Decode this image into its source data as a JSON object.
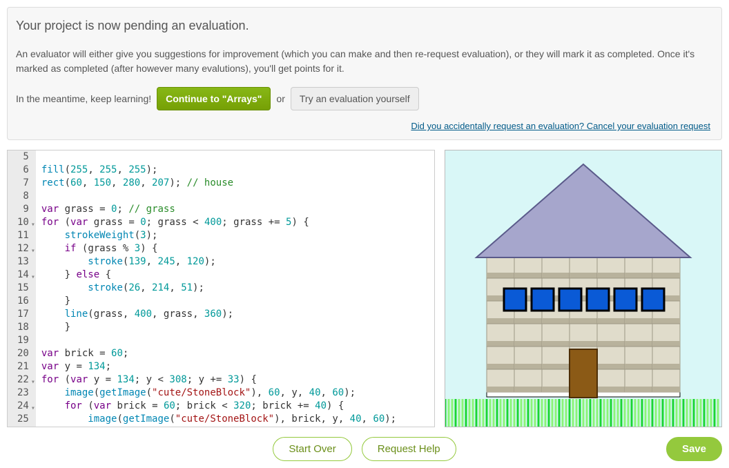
{
  "banner": {
    "title": "Your project is now pending an evaluation.",
    "text": "An evaluator will either give you suggestions for improvement (which you can make and then re-request evaluation), or they will mark it as completed. Once it's marked as completed (after however many evalutions), you'll get points for it.",
    "meantime": "In the meantime, keep learning!",
    "continue_btn": "Continue to \"Arrays\"",
    "or": "or",
    "try_btn": "Try an evaluation yourself",
    "cancel_link": "Did you accidentally request an evaluation? Cancel your evaluation request"
  },
  "gutter": [
    {
      "n": "5",
      "fold": false
    },
    {
      "n": "6",
      "fold": false
    },
    {
      "n": "7",
      "fold": false
    },
    {
      "n": "8",
      "fold": false
    },
    {
      "n": "9",
      "fold": false
    },
    {
      "n": "10",
      "fold": true
    },
    {
      "n": "11",
      "fold": false
    },
    {
      "n": "12",
      "fold": true
    },
    {
      "n": "13",
      "fold": false
    },
    {
      "n": "14",
      "fold": true
    },
    {
      "n": "15",
      "fold": false
    },
    {
      "n": "16",
      "fold": false
    },
    {
      "n": "17",
      "fold": false
    },
    {
      "n": "18",
      "fold": false
    },
    {
      "n": "19",
      "fold": false
    },
    {
      "n": "20",
      "fold": false
    },
    {
      "n": "21",
      "fold": false
    },
    {
      "n": "22",
      "fold": true
    },
    {
      "n": "23",
      "fold": false
    },
    {
      "n": "24",
      "fold": true
    },
    {
      "n": "25",
      "fold": false
    }
  ],
  "code_lines": [
    "",
    "<span class='typ'>fill</span><span class='pun'>(</span><span class='num'>255</span><span class='pun'>, </span><span class='num'>255</span><span class='pun'>, </span><span class='num'>255</span><span class='pun'>);</span>",
    "<span class='typ'>rect</span><span class='pun'>(</span><span class='num'>60</span><span class='pun'>, </span><span class='num'>150</span><span class='pun'>, </span><span class='num'>280</span><span class='pun'>, </span><span class='num'>207</span><span class='pun'>);</span> <span class='com'>// house</span>",
    "",
    "<span class='kw'>var</span> grass <span class='pun'>=</span> <span class='num'>0</span><span class='pun'>;</span> <span class='com'>// grass</span>",
    "<span class='kw'>for</span> <span class='pun'>(</span><span class='kw'>var</span> grass <span class='pun'>=</span> <span class='num'>0</span><span class='pun'>;</span> grass <span class='pun'>&lt;</span> <span class='num'>400</span><span class='pun'>;</span> grass <span class='pun'>+=</span> <span class='num'>5</span><span class='pun'>) {</span>",
    "    <span class='typ'>strokeWeight</span><span class='pun'>(</span><span class='num'>3</span><span class='pun'>);</span>",
    "    <span class='kw'>if</span> <span class='pun'>(</span>grass <span class='pun'>%</span> <span class='num'>3</span><span class='pun'>) {</span>",
    "        <span class='typ'>stroke</span><span class='pun'>(</span><span class='num'>139</span><span class='pun'>, </span><span class='num'>245</span><span class='pun'>, </span><span class='num'>120</span><span class='pun'>);</span>",
    "    <span class='pun'>}</span> <span class='kw'>else</span> <span class='pun'>{</span>",
    "        <span class='typ'>stroke</span><span class='pun'>(</span><span class='num'>26</span><span class='pun'>, </span><span class='num'>214</span><span class='pun'>, </span><span class='num'>51</span><span class='pun'>);</span>",
    "    <span class='pun'>}</span>",
    "    <span class='typ'>line</span><span class='pun'>(</span>grass<span class='pun'>, </span><span class='num'>400</span><span class='pun'>, </span>grass<span class='pun'>, </span><span class='num'>360</span><span class='pun'>);</span>",
    "    <span class='pun'>}</span>",
    "",
    "<span class='kw'>var</span> brick <span class='pun'>=</span> <span class='num'>60</span><span class='pun'>;</span>",
    "<span class='kw'>var</span> y <span class='pun'>=</span> <span class='num'>134</span><span class='pun'>;</span>",
    "<span class='kw'>for</span> <span class='pun'>(</span><span class='kw'>var</span> y <span class='pun'>=</span> <span class='num'>134</span><span class='pun'>;</span> y <span class='pun'>&lt;</span> <span class='num'>308</span><span class='pun'>;</span> y <span class='pun'>+=</span> <span class='num'>33</span><span class='pun'>) {</span>",
    "    <span class='typ'>image</span><span class='pun'>(</span><span class='typ'>getImage</span><span class='pun'>(</span><span class='str'>\"cute/StoneBlock\"</span><span class='pun'>), </span><span class='num'>60</span><span class='pun'>, </span>y<span class='pun'>, </span><span class='num'>40</span><span class='pun'>, </span><span class='num'>60</span><span class='pun'>);</span>",
    "    <span class='kw'>for</span> <span class='pun'>(</span><span class='kw'>var</span> brick <span class='pun'>=</span> <span class='num'>60</span><span class='pun'>;</span> brick <span class='pun'>&lt;</span> <span class='num'>320</span><span class='pun'>;</span> brick <span class='pun'>+=</span> <span class='num'>40</span><span class='pun'>) {</span>",
    "        <span class='typ'>image</span><span class='pun'>(</span><span class='typ'>getImage</span><span class='pun'>(</span><span class='str'>\"cute/StoneBlock\"</span><span class='pun'>), </span>brick<span class='pun'>, </span>y<span class='pun'>, </span><span class='num'>40</span><span class='pun'>, </span><span class='num'>60</span><span class='pun'>);</span>"
  ],
  "bottom": {
    "start_over": "Start Over",
    "request_help": "Request Help",
    "save": "Save"
  },
  "sketch": {
    "bg": "#d9f7f7",
    "roof": "#a6a6cc",
    "roof_stroke": "#5a5a8a",
    "door": "#8b5a16",
    "window_fill": "#0a5ad6",
    "window_stroke": "#000",
    "grass_light": "#8bf578",
    "grass_dark": "#1ad633",
    "stone_top": "#e0dccb",
    "stone_side": "#b8b29c",
    "stone_edge": "#9d9784"
  }
}
